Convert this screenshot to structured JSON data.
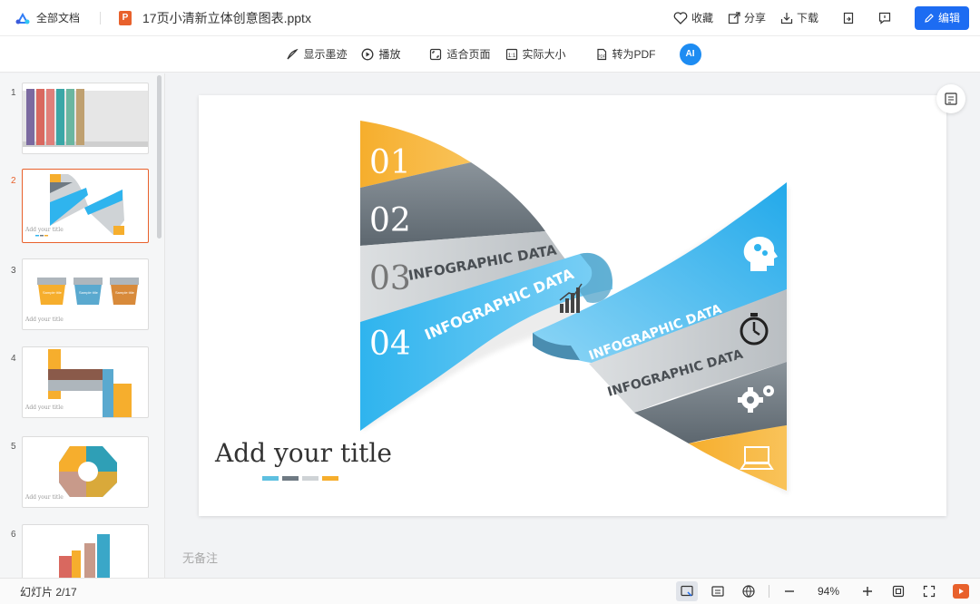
{
  "topbar": {
    "all_docs": "全部文档",
    "file_badge": "P",
    "filename": "17页小清新立体创意图表.pptx",
    "favorite": "收藏",
    "share": "分享",
    "download": "下载",
    "edit": "编辑"
  },
  "toolbar": {
    "show_ink": "显示墨迹",
    "play": "播放",
    "fit_page": "适合页面",
    "actual_size": "实际大小",
    "to_pdf": "转为PDF",
    "ai": "AI"
  },
  "sidebar": {
    "thumbs": [
      {
        "num": "1"
      },
      {
        "num": "2"
      },
      {
        "num": "3"
      },
      {
        "num": "4"
      },
      {
        "num": "5"
      },
      {
        "num": "6"
      }
    ],
    "thumb_caption": "Add your title",
    "thumb_label": "Sample title"
  },
  "slide": {
    "numbers": [
      "01",
      "02",
      "03",
      "04"
    ],
    "ribbon_text": "INFOGRAPHIC DATA",
    "title": "Add your title",
    "colors": {
      "orange": "#f6ae2d",
      "gray": "#6f7a83",
      "light": "#cfd3d6",
      "blue": "#2fb4ee"
    }
  },
  "notes": "无备注",
  "status": {
    "slide_counter": "幻灯片 2/17",
    "zoom": "94%"
  }
}
